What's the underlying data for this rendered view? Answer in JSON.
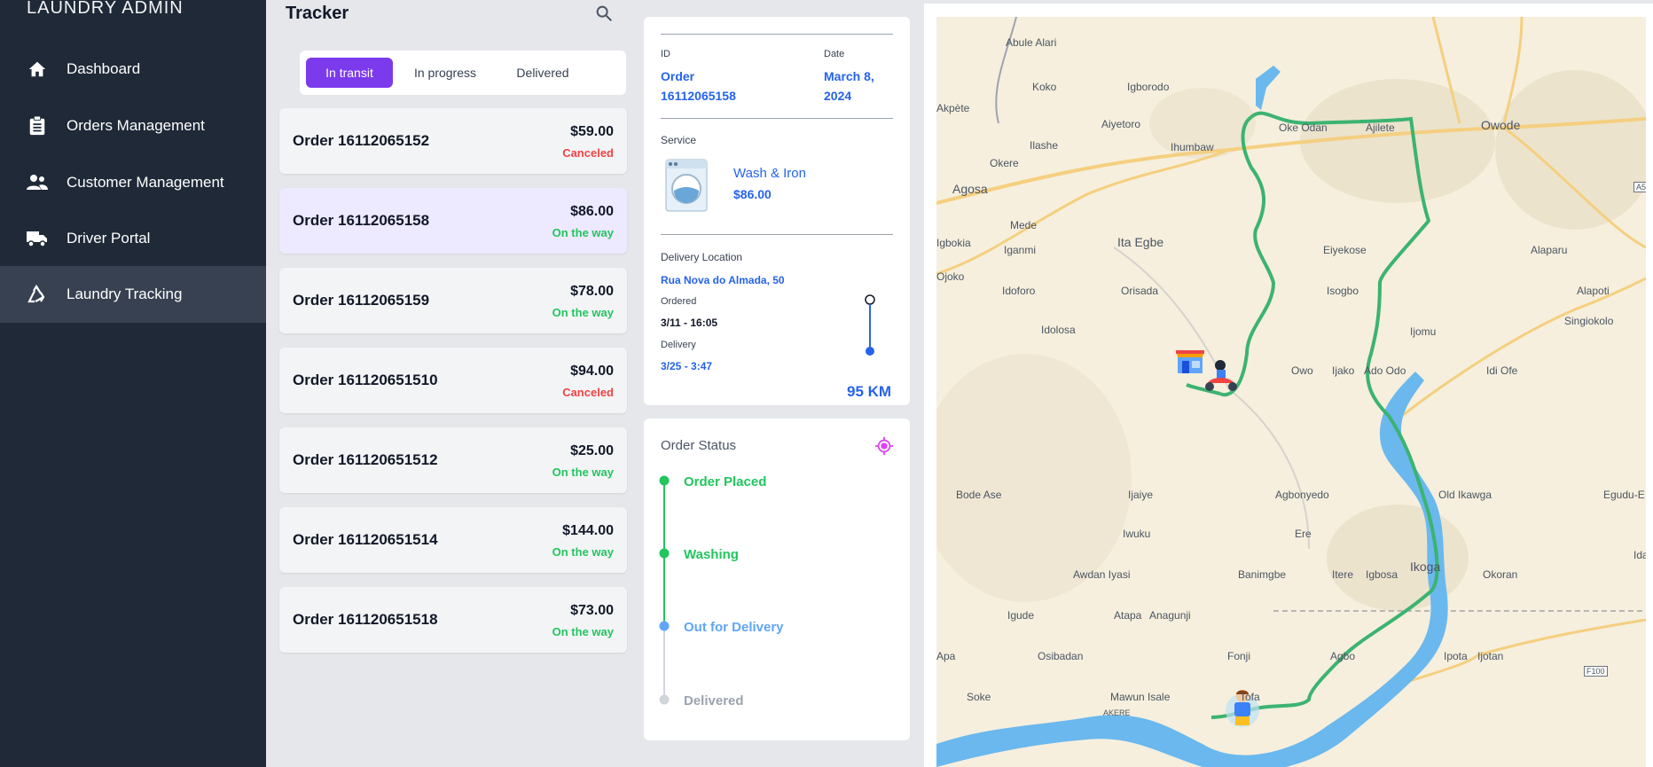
{
  "app": {
    "brand": "LAUNDRY ADMIN"
  },
  "sidebar": {
    "items": [
      {
        "label": "Dashboard",
        "icon": "home-icon"
      },
      {
        "label": "Orders Management",
        "icon": "clipboard-icon"
      },
      {
        "label": "Customer Management",
        "icon": "users-icon"
      },
      {
        "label": "Driver Portal",
        "icon": "truck-icon"
      },
      {
        "label": "Laundry Tracking",
        "icon": "recycle-icon",
        "active": true
      }
    ]
  },
  "tracker": {
    "title": "Tracker",
    "tabs": [
      {
        "label": "In transit",
        "active": true
      },
      {
        "label": "In progress"
      },
      {
        "label": "Delivered"
      }
    ],
    "orders": [
      {
        "name": "Order 16112065152",
        "price": "$59.00",
        "status": "Canceled"
      },
      {
        "name": "Order 16112065158",
        "price": "$86.00",
        "status": "On the way",
        "selected": true
      },
      {
        "name": "Order 16112065159",
        "price": "$78.00",
        "status": "On the way"
      },
      {
        "name": "Order 161120651510",
        "price": "$94.00",
        "status": "Canceled"
      },
      {
        "name": "Order 161120651512",
        "price": "$25.00",
        "status": "On the way"
      },
      {
        "name": "Order 161120651514",
        "price": "$144.00",
        "status": "On the way"
      },
      {
        "name": "Order 161120651518",
        "price": "$73.00",
        "status": "On the way"
      }
    ]
  },
  "details": {
    "id_label": "ID",
    "id_value_line1": "Order",
    "id_value_line2": "16112065158",
    "date_label": "Date",
    "date_line1": "March 8,",
    "date_line2": "2024",
    "service_label": "Service",
    "service_name": "Wash & Iron",
    "service_price": "$86.00",
    "location_label": "Delivery Location",
    "location_value": "Rua Nova do Almada, 50",
    "ordered_label": "Ordered",
    "ordered_value": "3/11 - 16:05",
    "delivery_label": "Delivery",
    "delivery_value": "3/25 - 3:47",
    "distance": "95 KM"
  },
  "order_status": {
    "title": "Order Status",
    "steps": [
      {
        "label": "Order Placed",
        "state": "done"
      },
      {
        "label": "Washing",
        "state": "done"
      },
      {
        "label": "Out for Delivery",
        "state": "current"
      },
      {
        "label": "Delivered",
        "state": "pending"
      }
    ]
  },
  "colors": {
    "sidebar": "#1f2937",
    "accent": "#7c3aed",
    "green": "#22c55e",
    "red": "#ef4444",
    "blue": "#2563eb",
    "route": "#3cb371",
    "water": "#6ab8ee"
  },
  "map": {
    "labels": [
      "Abule Alari",
      "Koko",
      "Igborodo",
      "Akpète",
      "Aiyetoro",
      "Oke Odan",
      "Ajilete",
      "Owode",
      "Ilashe",
      "Ihumbaw",
      "Okere",
      "Agosa",
      "Mede",
      "Ita Egbe",
      "Eiyekose",
      "Alaparu",
      "Igbokia",
      "Iganmi",
      "Ojoko",
      "Idoforo",
      "Orisada",
      "Isogbo",
      "Alapoti",
      "Singiokolo",
      "Idolosa",
      "Ijomu",
      "Owo",
      "Ijako",
      "Ado Odo",
      "Idi Ofe",
      "Bode Ase",
      "Ijaiye",
      "Agbonyedo",
      "Old Ikawga",
      "Egudu-E",
      "Iwuku",
      "Ere",
      "Awdan Iyasi",
      "Banimgbe",
      "Itere",
      "Igbosa",
      "Ikoga",
      "Okoran",
      "Igude",
      "Atapa",
      "Anagunji",
      "Apa",
      "Osibadan",
      "Fonji",
      "Agbo",
      "Ipota",
      "Ijotan",
      "Soke",
      "Mawun Isale",
      "Tofa",
      "AKERE",
      "F100",
      "A5",
      "Ida",
      "Ida"
    ]
  }
}
